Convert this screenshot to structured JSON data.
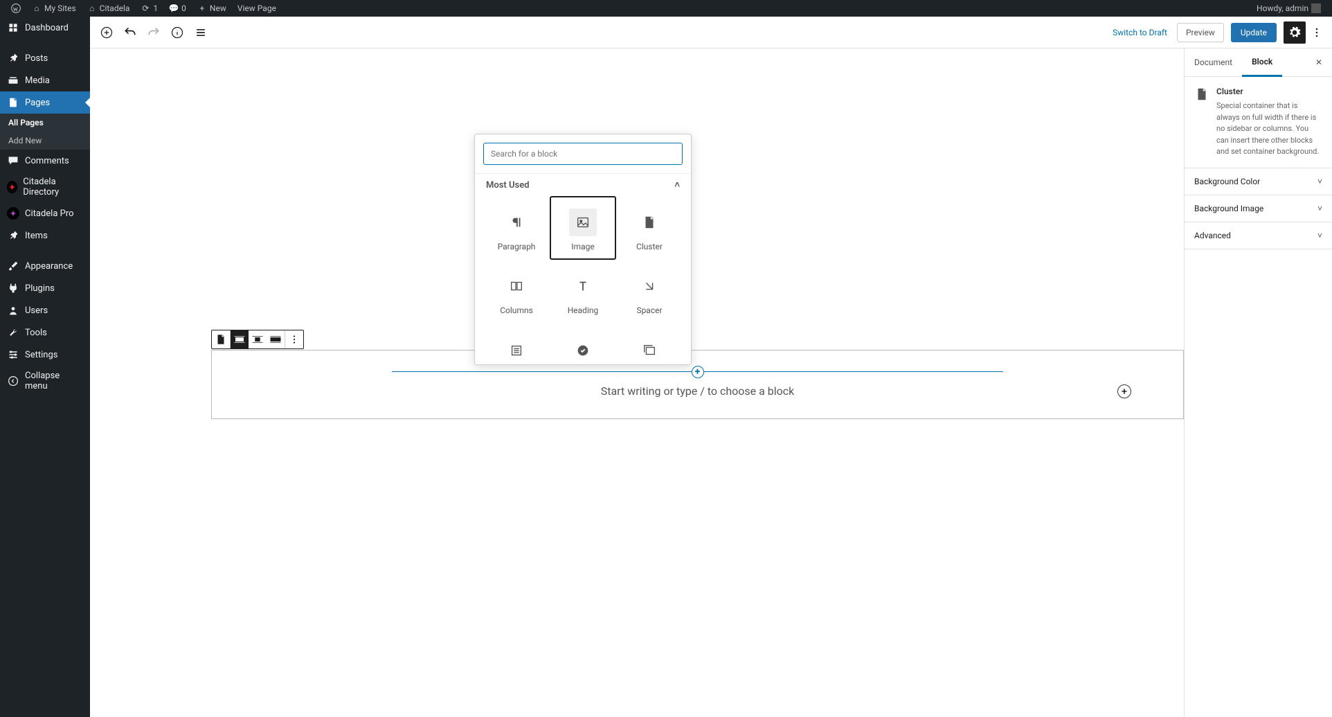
{
  "adminbar": {
    "mysites": "My Sites",
    "site": "Citadela",
    "updates": "1",
    "comments": "0",
    "new": "New",
    "view": "View Page",
    "greeting": "Howdy, admin"
  },
  "sidebar": {
    "dashboard": "Dashboard",
    "posts": "Posts",
    "media": "Media",
    "pages": "Pages",
    "pages_sub": {
      "all": "All Pages",
      "add": "Add New"
    },
    "comments": "Comments",
    "cit_dir": "Citadela Directory",
    "cit_pro": "Citadela Pro",
    "items": "Items",
    "appearance": "Appearance",
    "plugins": "Plugins",
    "users": "Users",
    "tools": "Tools",
    "settings": "Settings",
    "collapse": "Collapse menu"
  },
  "editor_header": {
    "switch_draft": "Switch to Draft",
    "preview": "Preview",
    "update": "Update"
  },
  "inserter": {
    "search_placeholder": "Search for a block",
    "cat_most_used": "Most Used",
    "blocks": {
      "paragraph": "Paragraph",
      "image": "Image",
      "cluster": "Cluster",
      "columns": "Columns",
      "heading": "Heading",
      "spacer": "Spacer",
      "dir_items": "Directory Items List",
      "service": "Service",
      "gallery": "Gallery"
    }
  },
  "cluster_placeholder": "Start writing or type / to choose a block",
  "settings": {
    "tab_document": "Document",
    "tab_block": "Block",
    "block_title": "Cluster",
    "block_desc": "Special container that is always on full width if there is no sidebar or columns. You can insert there other blocks and set container background.",
    "panel_bg_color": "Background Color",
    "panel_bg_image": "Background Image",
    "panel_advanced": "Advanced"
  }
}
